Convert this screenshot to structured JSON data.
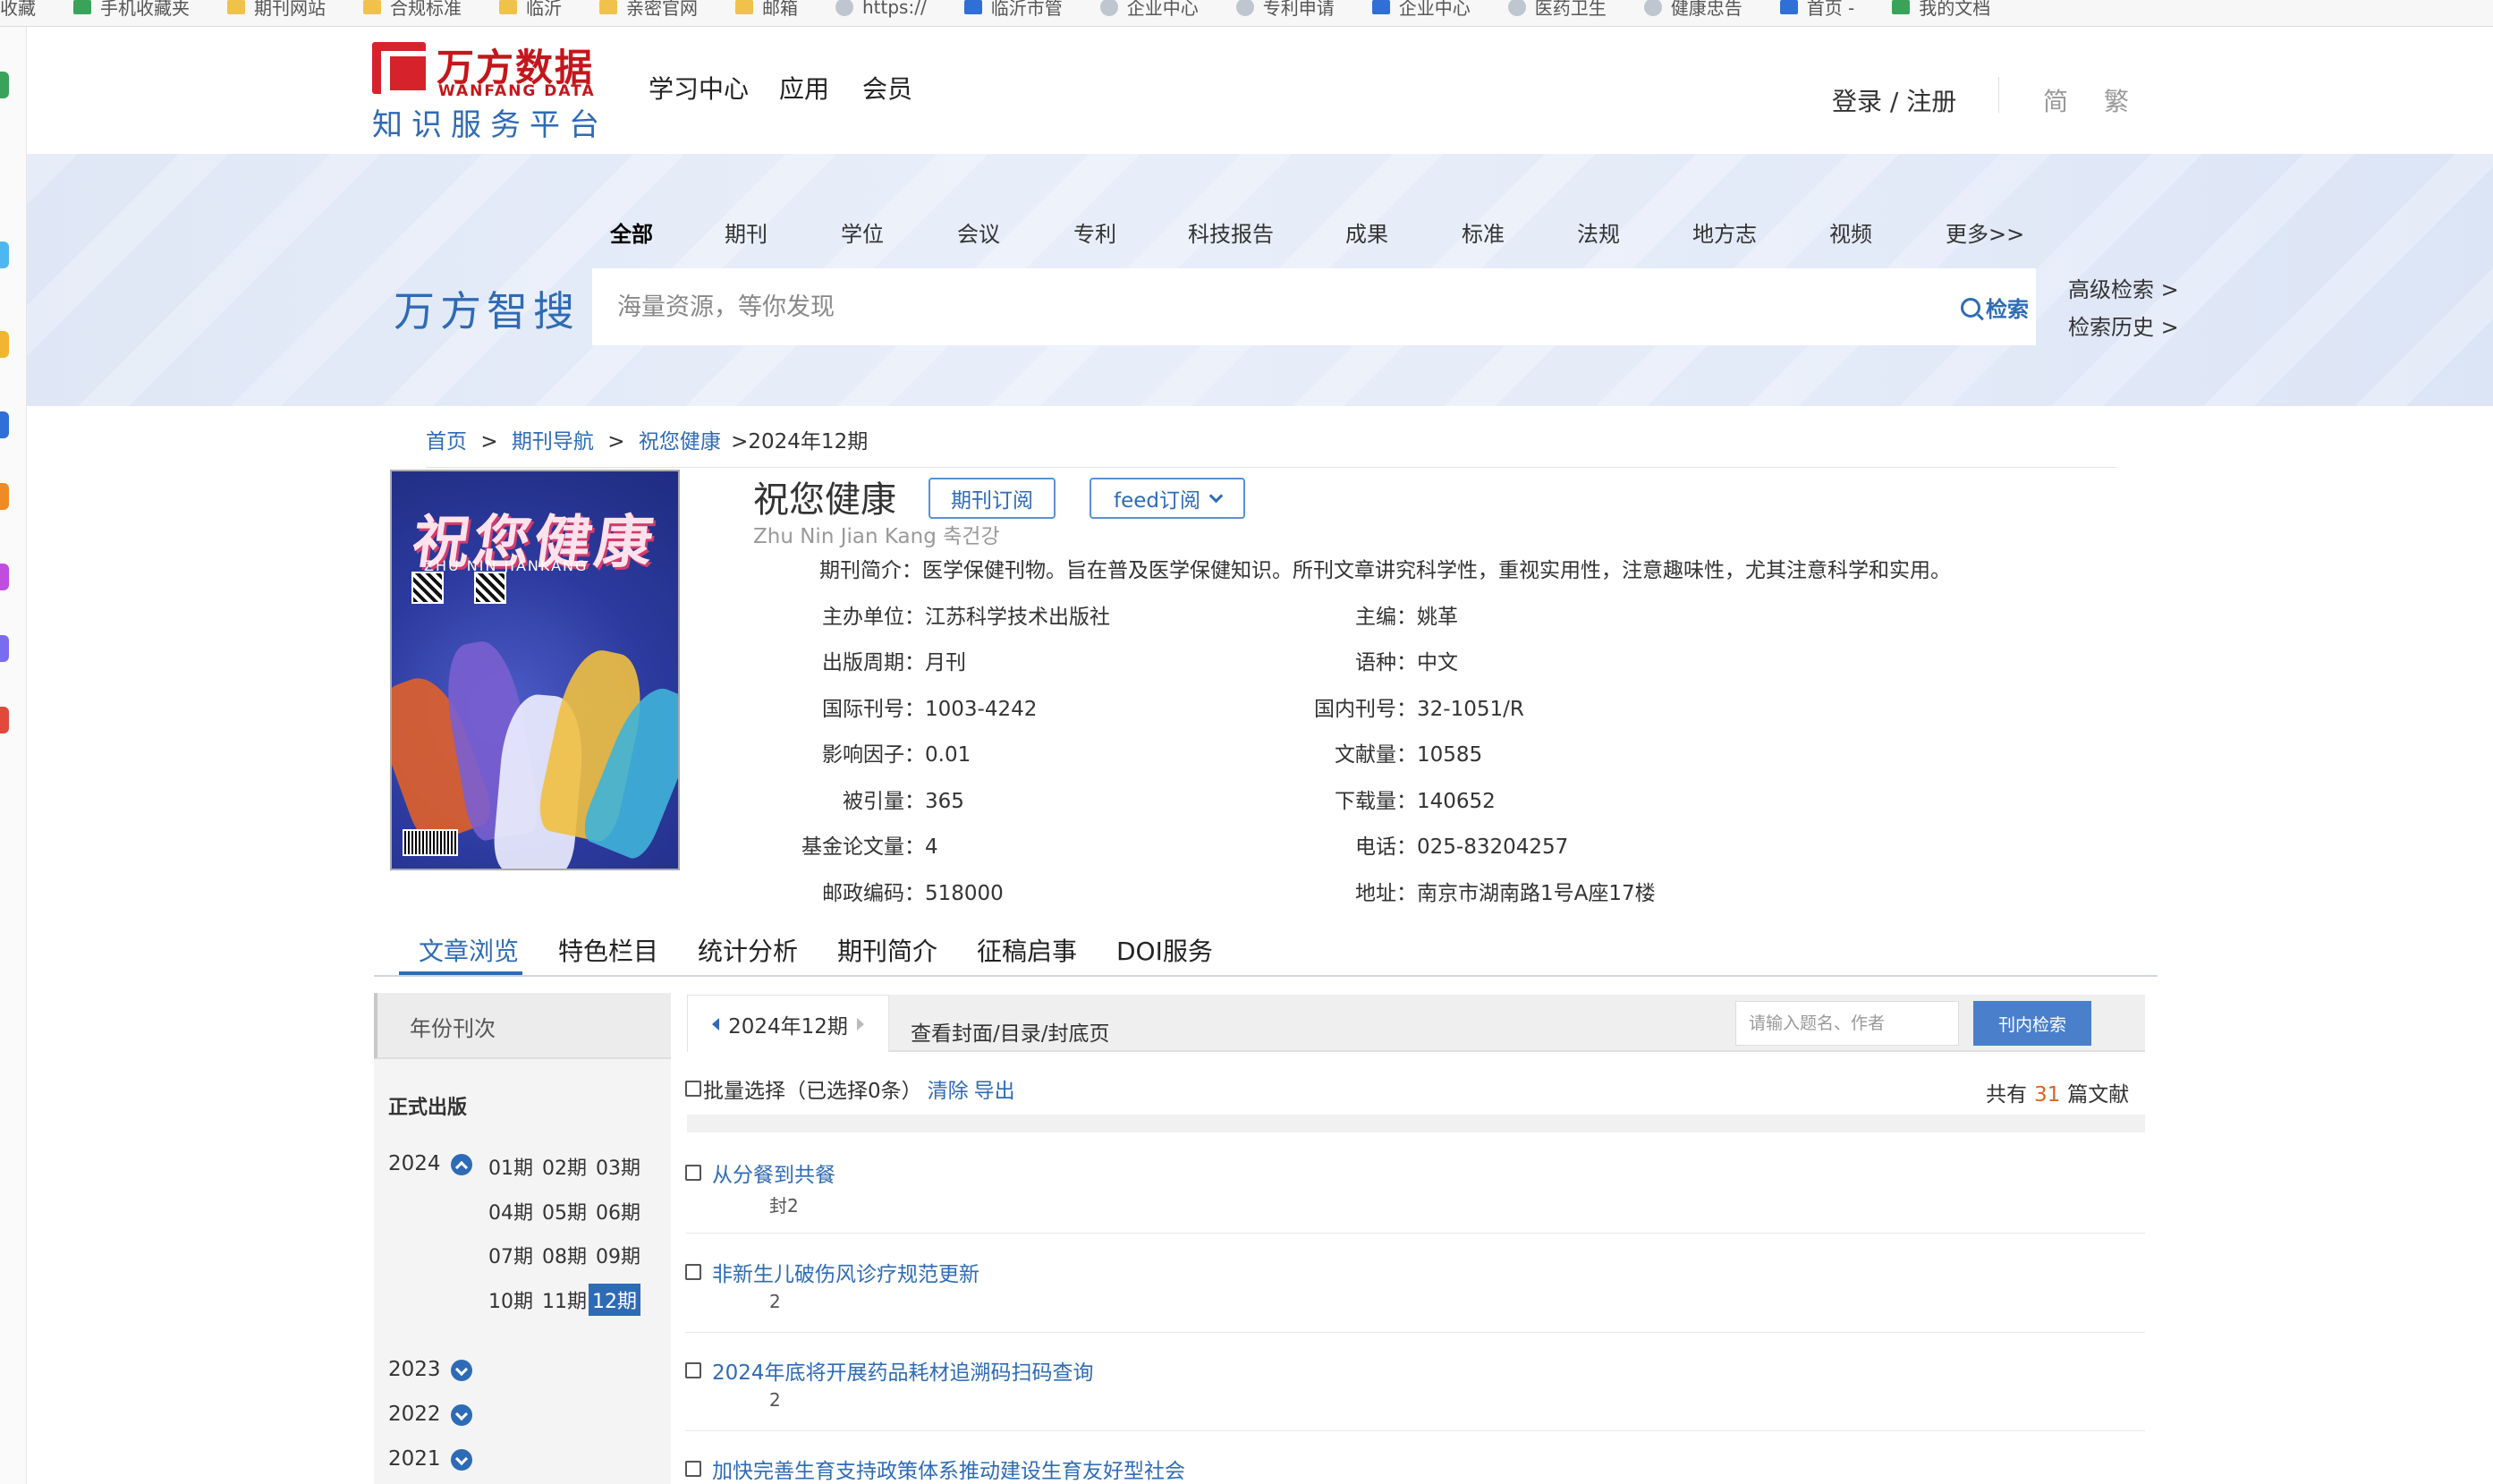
{
  "bookmarks": [
    "收藏",
    "手机收藏夹",
    "期刊网站",
    "合规标准",
    "临沂",
    "亲密官网",
    "邮箱",
    "https://",
    "临沂市管",
    "企业中心",
    "专利申请",
    "企业中心",
    "医药卫生",
    "健康忠告",
    "首页 -",
    "我的文档"
  ],
  "header": {
    "logo_cn": "万方数据",
    "logo_en": "WANFANG DATA",
    "logo_sub": "知识服务平台",
    "nav": [
      "学习中心",
      "应用",
      "会员"
    ],
    "login": "登录 / 注册",
    "lang_simplified": "简",
    "lang_traditional": "繁"
  },
  "search": {
    "tabs": [
      "全部",
      "期刊",
      "学位",
      "会议",
      "专利",
      "科技报告",
      "成果",
      "标准",
      "法规",
      "地方志",
      "视频",
      "更多>>"
    ],
    "brand": "万方智搜",
    "placeholder": "海量资源，等你发现",
    "button": "检索",
    "advanced": "高级检索 >",
    "history": "检索历史 >"
  },
  "breadcrumb": {
    "home": "首页",
    "sep1": ">",
    "nav": "期刊导航",
    "sep2": ">",
    "journal": "祝您健康",
    "current": ">2024年12期"
  },
  "journal": {
    "cover_title": "祝您健康",
    "cover_sub": "ZHU NIN JIANKANG",
    "title": "祝您健康",
    "pinyin": "Zhu Nin Jian Kang 축건강",
    "subscribe": "期刊订阅",
    "feed": "feed订阅",
    "intro_label": "期刊简介：",
    "intro": "医学保健刊物。旨在普及医学保健知识。所刊文章讲究科学性，重视实用性，注意趣味性，尤其注意科学和实用。",
    "left_fields": [
      {
        "label": "主办单位：",
        "value": "江苏科学技术出版社"
      },
      {
        "label": "出版周期：",
        "value": "月刊"
      },
      {
        "label": "国际刊号：",
        "value": "1003-4242"
      },
      {
        "label": "影响因子：",
        "value": "0.01"
      },
      {
        "label": "被引量：",
        "value": "365"
      },
      {
        "label": "基金论文量：",
        "value": "4"
      },
      {
        "label": "邮政编码：",
        "value": "518000"
      }
    ],
    "right_fields": [
      {
        "label": "主编：",
        "value": "姚革"
      },
      {
        "label": "语种：",
        "value": "中文"
      },
      {
        "label": "国内刊号：",
        "value": "32-1051/R"
      },
      {
        "label": "文献量：",
        "value": "10585"
      },
      {
        "label": "下载量：",
        "value": "140652"
      },
      {
        "label": "电话：",
        "value": "025-83204257"
      },
      {
        "label": "地址：",
        "value": "南京市湖南路1号A座17楼"
      }
    ]
  },
  "content_tabs": [
    "文章浏览",
    "特色栏目",
    "统计分析",
    "期刊简介",
    "征稿启事",
    "DOI服务"
  ],
  "sidebar": {
    "head": "年份刊次",
    "published": "正式出版",
    "years": [
      "2024",
      "2023",
      "2022",
      "2021"
    ],
    "issues": [
      "01期",
      "02期",
      "03期",
      "04期",
      "05期",
      "06期",
      "07期",
      "08期",
      "09期",
      "10期",
      "11期",
      "12期"
    ],
    "selected_issue": "12期"
  },
  "toolbar": {
    "issue": "2024年12期",
    "cover_link": "查看封面/目录/封底页",
    "search_placeholder": "请输入题名、作者",
    "search_button": "刊内检索"
  },
  "batch": {
    "label": "批量选择（已选择0条）",
    "clear": "清除",
    "export": "导出",
    "total_prefix": "共有",
    "total": "31",
    "total_suffix": "篇文献"
  },
  "articles": [
    {
      "title": "从分餐到共餐",
      "page": "封2"
    },
    {
      "title": "非新生儿破伤风诊疗规范更新",
      "page": "2"
    },
    {
      "title": "2024年底将开展药品耗材追溯码扫码查询",
      "page": "2"
    },
    {
      "title": "加快完善生育支持政策体系推动建设生育友好型社会",
      "page": ""
    }
  ],
  "colors": {
    "brand_red": "#c4161c",
    "brand_blue": "#2e6bb6",
    "count_orange": "#e0621f"
  }
}
